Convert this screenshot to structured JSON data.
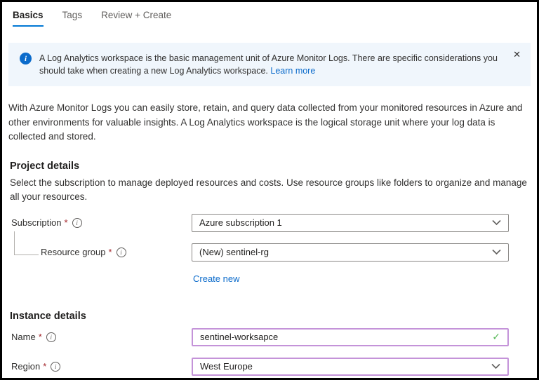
{
  "required_mark": "*",
  "icons": {
    "info_badge": "i",
    "info_circle": "i",
    "close": "✕",
    "check": "✓"
  },
  "colors": {
    "accent_blue": "#0078d4",
    "banner_bg": "#f0f6fc",
    "required_red": "#a4262c",
    "valid_green": "#57b857",
    "focus_purple": "#c493d9"
  },
  "tabs": {
    "basics": "Basics",
    "tags": "Tags",
    "review_create": "Review + Create"
  },
  "banner": {
    "message": "A Log Analytics workspace is the basic management unit of Azure Monitor Logs. There are specific considerations you should take when creating a new Log Analytics workspace.",
    "link_label": "Learn more"
  },
  "intro_paragraph": "With Azure Monitor Logs you can easily store, retain, and query data collected from your monitored resources in Azure and other environments for valuable insights. A Log Analytics workspace is the logical storage unit where your log data is collected and stored.",
  "project_details": {
    "heading": "Project details",
    "description": "Select the subscription to manage deployed resources and costs. Use resource groups like folders to organize and manage all your resources.",
    "subscription_label": "Subscription",
    "subscription_value": "Azure subscription 1",
    "resource_group_label": "Resource group",
    "resource_group_value": "(New) sentinel-rg",
    "create_new_label": "Create new"
  },
  "instance_details": {
    "heading": "Instance details",
    "name_label": "Name",
    "name_value": "sentinel-worksapce",
    "region_label": "Region",
    "region_value": "West Europe"
  }
}
